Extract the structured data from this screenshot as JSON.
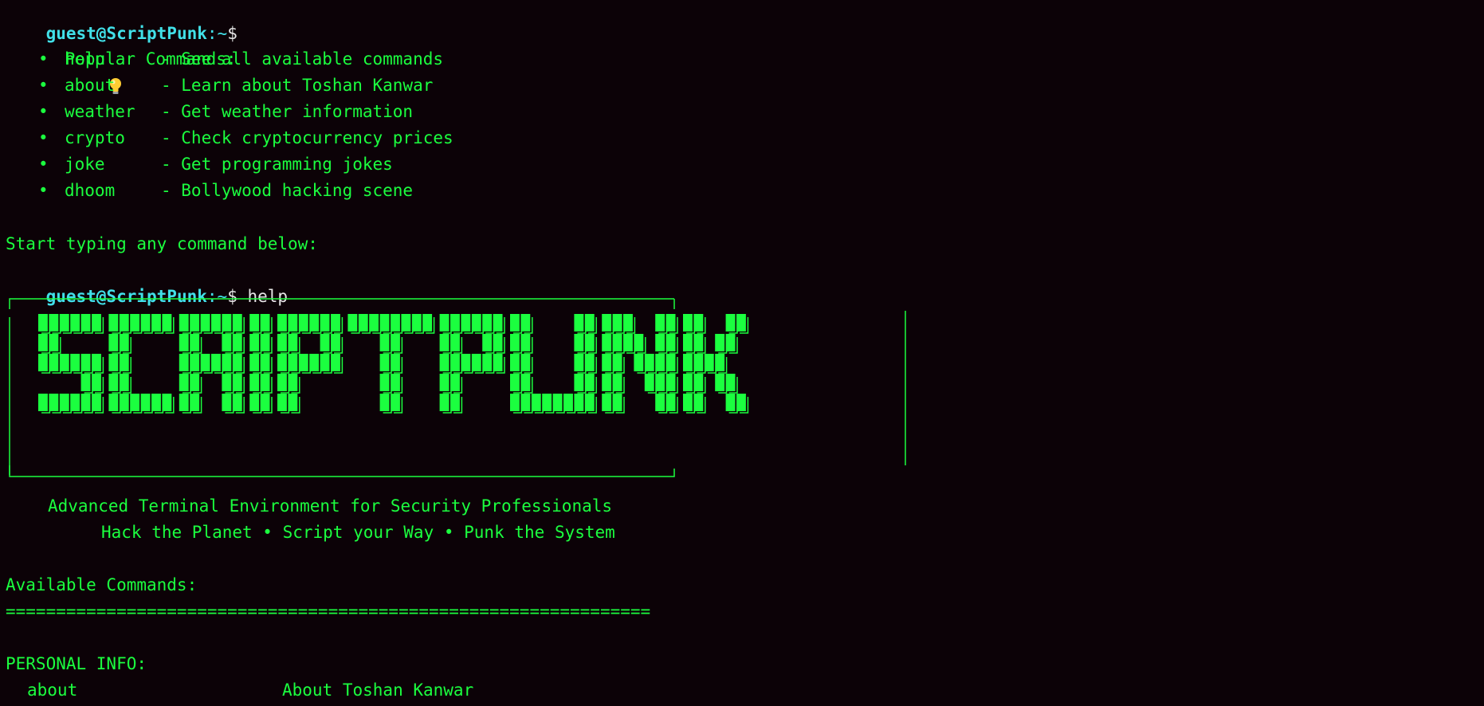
{
  "prompt": {
    "user": "guest@ScriptPunk",
    "sep": ":",
    "path": "~",
    "symbol": "$"
  },
  "popular": {
    "title": "Popular Commands:",
    "icon": "lightbulb-icon",
    "bullet": "•",
    "items": [
      {
        "name": "help",
        "desc": "- See all available commands"
      },
      {
        "name": "about",
        "desc": "- Learn about Toshan Kanwar"
      },
      {
        "name": "weather",
        "desc": "- Get weather information"
      },
      {
        "name": "crypto",
        "desc": "- Check cryptocurrency prices"
      },
      {
        "name": "joke",
        "desc": "- Get programming jokes"
      },
      {
        "name": "dhoom",
        "desc": "- Bollywood hacking scene"
      }
    ]
  },
  "start_hint": "Start typing any command below:",
  "entered_command": "help",
  "banner": {
    "icon": "scriptpunk-ascii-logo",
    "tagline_1": "Advanced Terminal Environment for Security Professionals",
    "tagline_2": "Hack the Planet • Script your Way • Punk the System"
  },
  "help": {
    "title": "Available Commands:",
    "rule": "================================================================",
    "section": "PERSONAL INFO:",
    "items": [
      {
        "name": "about",
        "desc": "About Toshan Kanwar"
      }
    ]
  },
  "colors": {
    "background": "#0c0207",
    "text": "#1bff3f",
    "prompt": "#41e0e8",
    "input": "#e6e6e6"
  }
}
